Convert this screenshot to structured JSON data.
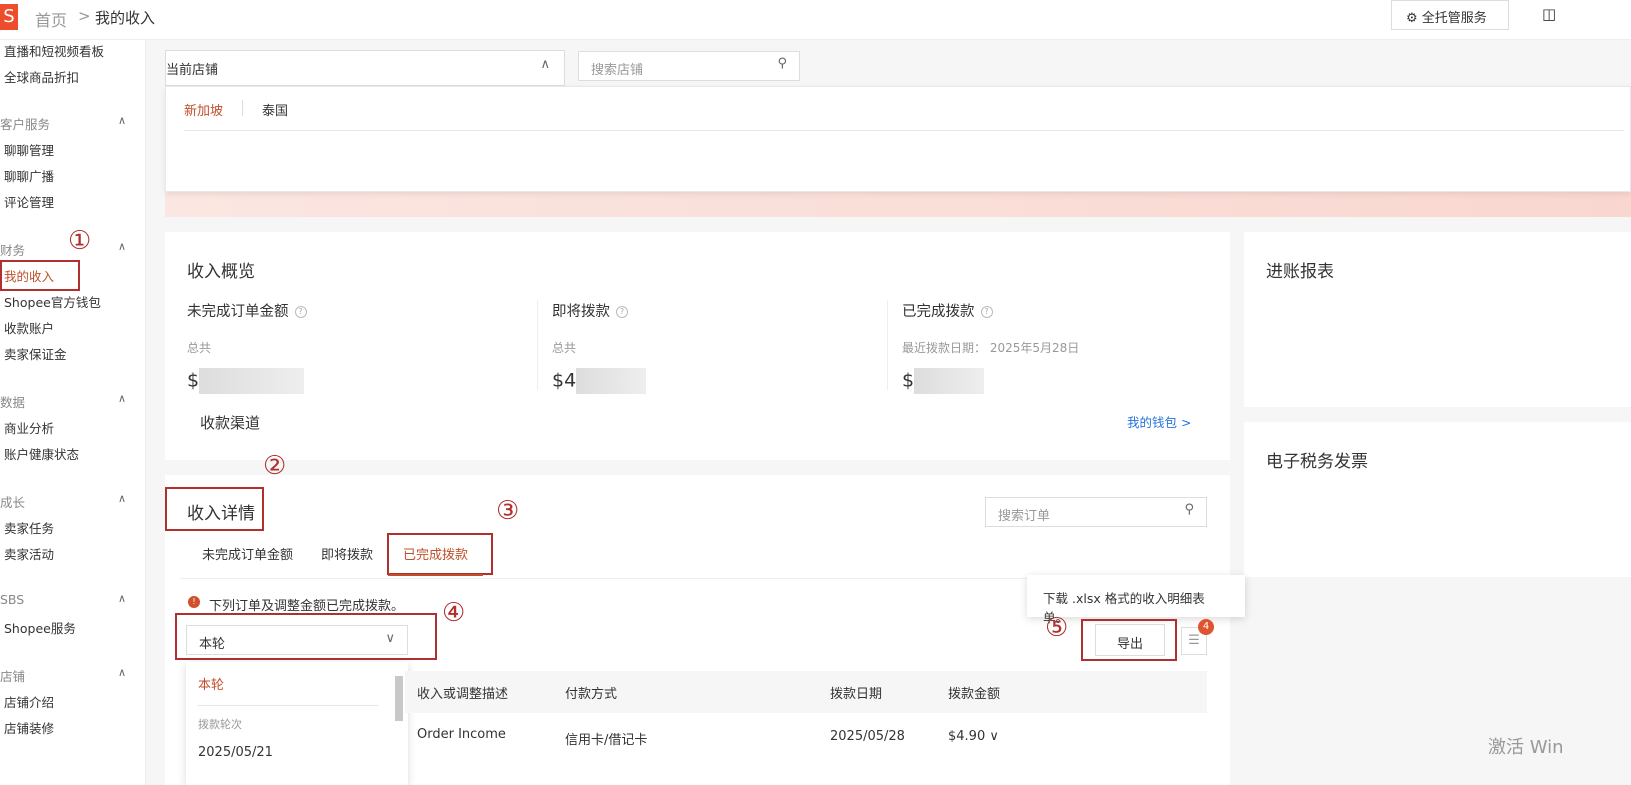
{
  "header": {
    "logo": "S",
    "breadcrumb_home": "首页",
    "breadcrumb_sep": ">",
    "breadcrumb_current": "我的收入",
    "managed_service": "全托管服务"
  },
  "sidebar": {
    "items_top": [
      "直播和短视频看板",
      "全球商品折扣"
    ],
    "sections": [
      {
        "title": "客户服务",
        "items": [
          "聊聊管理",
          "聊聊广播",
          "评论管理"
        ]
      },
      {
        "title": "财务",
        "items": [
          "我的收入",
          "Shopee官方钱包",
          "收款账户",
          "卖家保证金"
        ]
      },
      {
        "title": "数据",
        "items": [
          "商业分析",
          "账户健康状态"
        ]
      },
      {
        "title": "成长",
        "items": [
          "卖家任务",
          "卖家活动"
        ]
      },
      {
        "title": "SBS",
        "items": [
          "Shopee服务"
        ]
      },
      {
        "title": "店铺",
        "items": [
          "店铺介绍",
          "店铺装修"
        ]
      }
    ]
  },
  "shop_selector": {
    "label": "当前店铺",
    "search_placeholder": "搜索店铺",
    "tabs": [
      "新加坡",
      "泰国"
    ]
  },
  "overview": {
    "title": "收入概览",
    "cols": [
      {
        "title": "未完成订单金额",
        "sub": "总共",
        "amount": "$"
      },
      {
        "title": "即将拨款",
        "sub": "总共",
        "amount": "$4"
      },
      {
        "title": "已完成拨款",
        "sub": "最近拨款日期： 2025年5月28日",
        "amount": "$"
      }
    ],
    "channel": "收款渠道",
    "wallet_link": "我的钱包 >"
  },
  "right_panels": {
    "report": "进账报表",
    "tax": "电子税务发票"
  },
  "details": {
    "title": "收入详情",
    "search_placeholder": "搜索订单",
    "tabs": [
      "未完成订单金额",
      "即将拨款",
      "已完成拨款"
    ],
    "notice": "下列订单及调整金额已完成拨款。",
    "period": "本轮",
    "dropdown": {
      "selected": "本轮",
      "group": "拨款轮次",
      "option": "2025/05/21"
    },
    "tooltip": "下载 .xlsx 格式的收入明细表单。",
    "export": "导出",
    "badge": "4",
    "columns": [
      "收入或调整描述",
      "付款方式",
      "拨款日期",
      "拨款金额"
    ],
    "rows": [
      {
        "desc": "Order Income",
        "method": "信用卡/借记卡",
        "date": "2025/05/28",
        "amount": "$4.90 ∨"
      }
    ]
  },
  "annotations": [
    "①",
    "②",
    "③",
    "④",
    "⑤"
  ],
  "watermark": "激活 Win"
}
